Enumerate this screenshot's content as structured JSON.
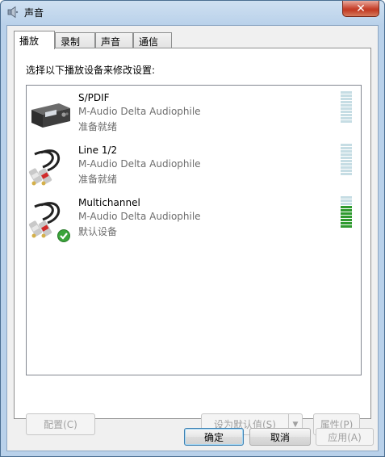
{
  "window": {
    "title": "声音",
    "close_glyph": "✕",
    "title_icon": "speaker-icon"
  },
  "tabs": [
    {
      "label": "播放",
      "active": true
    },
    {
      "label": "录制",
      "active": false
    },
    {
      "label": "声音",
      "active": false
    },
    {
      "label": "通信",
      "active": false
    }
  ],
  "playback": {
    "instruction": "选择以下播放设备来修改设置:",
    "devices": [
      {
        "name": "S/PDIF",
        "driver": "M-Audio Delta Audiophile",
        "status": "准备就绪",
        "icon": "spdif-receiver-icon",
        "level": 0.0,
        "is_default": false
      },
      {
        "name": "Line 1/2",
        "driver": "M-Audio Delta Audiophile",
        "status": "准备就绪",
        "icon": "rca-cable-icon",
        "level": 0.0,
        "is_default": false
      },
      {
        "name": "Multichannel",
        "driver": "M-Audio Delta Audiophile",
        "status": "默认设备",
        "icon": "rca-cable-icon",
        "level": 0.7,
        "is_default": true
      }
    ]
  },
  "panel_buttons": {
    "configure": "配置(C)",
    "set_default": "设为默认值(S)",
    "properties": "属性(P)"
  },
  "dialog_buttons": {
    "ok": "确定",
    "cancel": "取消",
    "apply": "应用(A)"
  },
  "colors": {
    "meter_on": "#2f9a2f",
    "meter_off": "#c6dde4",
    "default_check": "#3aa43a"
  }
}
